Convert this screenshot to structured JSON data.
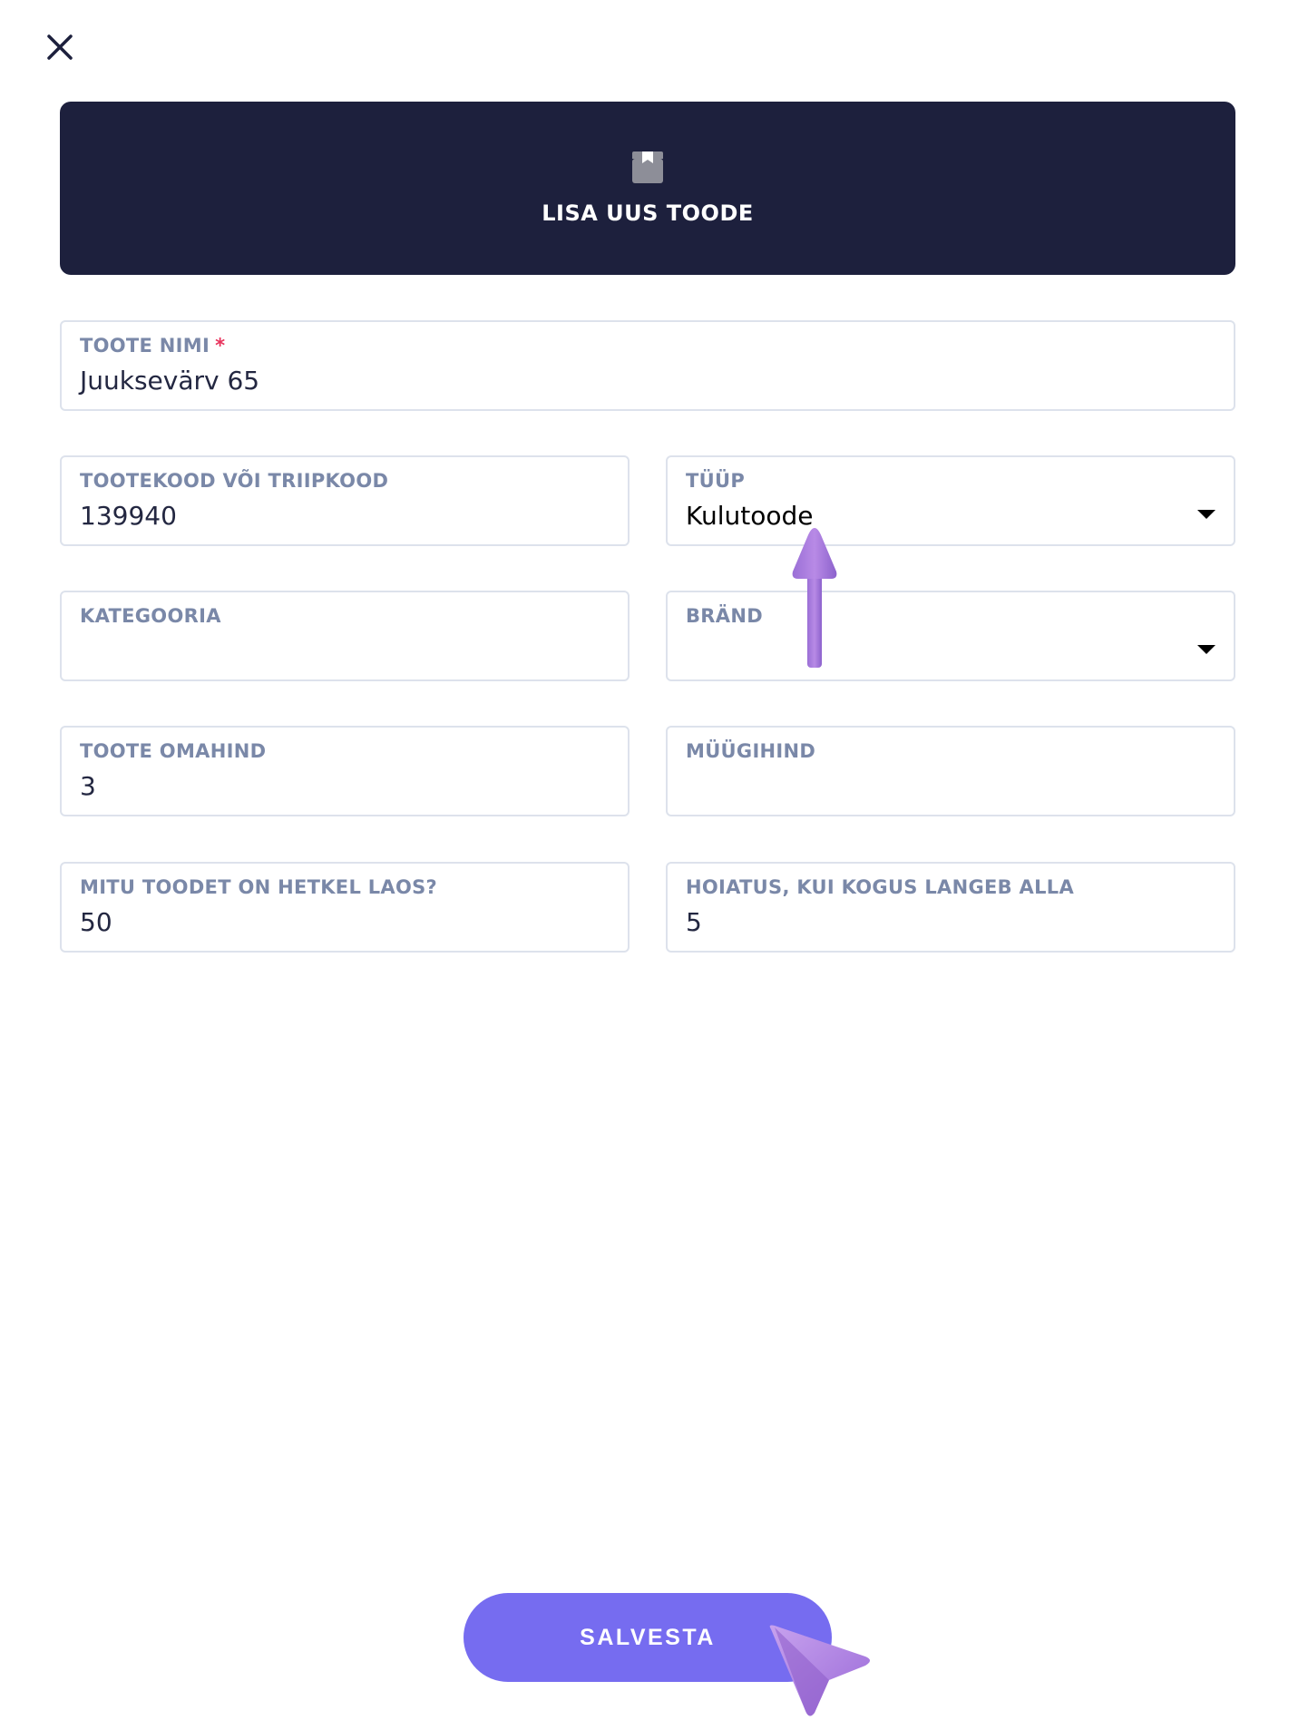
{
  "header": {
    "title": "LISA UUS TOODE",
    "icon": "box-icon"
  },
  "form": {
    "product_name": {
      "label": "TOOTE NIMI",
      "required_marker": "*",
      "value": "Juuksevärv 65"
    },
    "product_code": {
      "label": "TOOTEKOOD VÕI TRIIPKOOD",
      "value": "139940"
    },
    "type": {
      "label": "TÜÜP",
      "value": "Kulutoode"
    },
    "category": {
      "label": "KATEGOORIA",
      "value": ""
    },
    "brand": {
      "label": "BRÄND",
      "value": ""
    },
    "cost_price": {
      "label": "TOOTE OMAHIND",
      "value": "3"
    },
    "sale_price": {
      "label": "MÜÜGIHIND",
      "value": ""
    },
    "stock_count": {
      "label": "MITU TOODET ON HETKEL LAOS?",
      "value": "50"
    },
    "low_stock_warning": {
      "label": "HOIATUS, KUI KOGUS LANGEB ALLA",
      "value": "5"
    }
  },
  "actions": {
    "save_label": "SALVESTA"
  },
  "colors": {
    "header_bg": "#1d203d",
    "accent": "#766cf0",
    "label": "#7a88a8",
    "required": "#e8345d",
    "annotation": "#a57ad8"
  }
}
